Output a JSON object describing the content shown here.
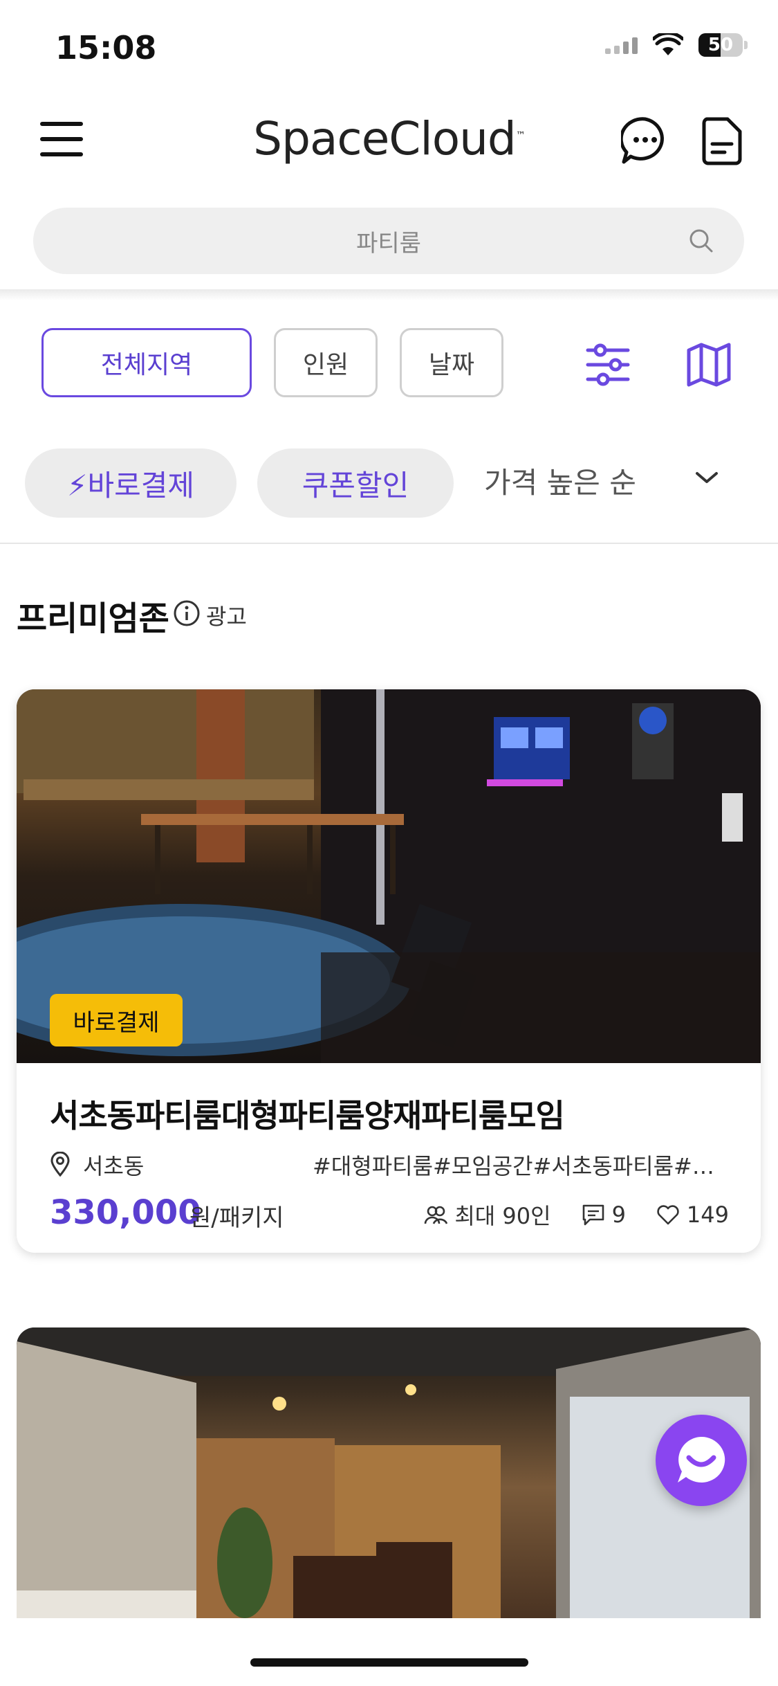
{
  "status_bar": {
    "time": "15:08",
    "battery": "50"
  },
  "header": {
    "logo": "SpaceCloud",
    "logo_tm": "™"
  },
  "search": {
    "placeholder": "파티룸"
  },
  "filters": {
    "region": "전체지역",
    "people": "인원",
    "date": "날짜"
  },
  "quick_filters": {
    "quick_pay": "⚡바로결제",
    "coupon": "쿠폰할인",
    "sort": "가격 높은 순"
  },
  "section": {
    "title": "프리미엄존",
    "ad_label": "광고"
  },
  "listings": [
    {
      "badge": "바로결제",
      "title": "서초동파티룸대형파티룸양재파티룸모임",
      "location": "서초동",
      "tags": "#대형파티룸#모임공간#서초동파티룸#…",
      "price": "330,000",
      "unit": "원/패키지",
      "capacity": "최대 90인",
      "reviews": "9",
      "likes": "149"
    }
  ],
  "colors": {
    "accent": "#5a3fd0",
    "badge": "#f5bd08",
    "fab": "#8a45f0"
  },
  "icons": [
    "menu-icon",
    "chat-icon",
    "document-icon",
    "search-icon",
    "filter-icon",
    "map-icon",
    "chevron-down-icon",
    "info-icon",
    "location-icon",
    "people-icon",
    "comment-icon",
    "heart-icon",
    "chatbot-icon"
  ]
}
